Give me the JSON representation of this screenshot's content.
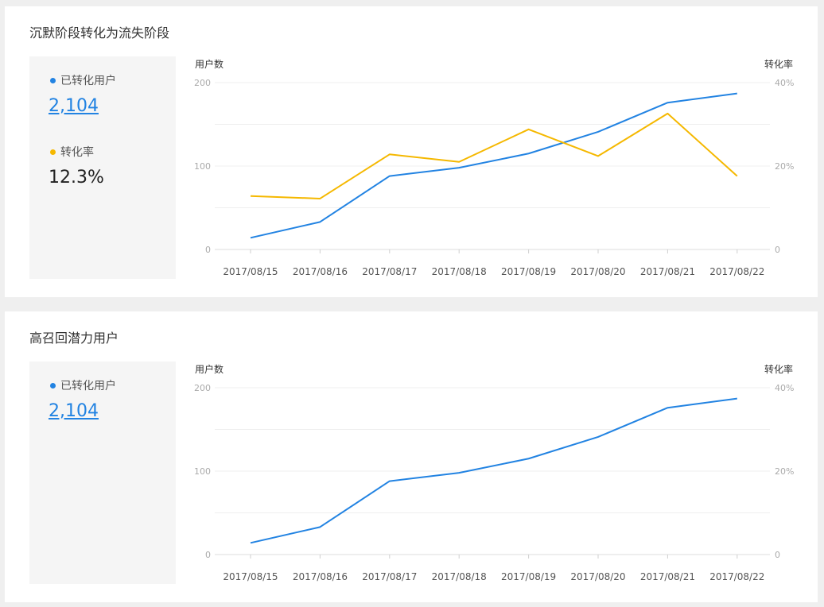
{
  "panels": [
    {
      "title": "沉默阶段转化为流失阶段",
      "metrics": [
        {
          "label": "已转化用户",
          "value": "2,104",
          "color": "#2283e2",
          "link": true
        },
        {
          "label": "转化率",
          "value": "12.3%",
          "color": "#f5b800",
          "link": false
        }
      ],
      "chart_data": {
        "type": "line",
        "x": [
          "2017/08/15",
          "2017/08/16",
          "2017/08/17",
          "2017/08/18",
          "2017/08/19",
          "2017/08/20",
          "2017/08/21",
          "2017/08/22"
        ],
        "ylabel": "用户数",
        "y2label": "转化率",
        "ylim": [
          0,
          200
        ],
        "y2lim": [
          0,
          40
        ],
        "yticks": [
          "0",
          "100",
          "200"
        ],
        "y2ticks": [
          "0",
          "20%",
          "40%"
        ],
        "grid": true,
        "series": [
          {
            "axis": "left",
            "color": "#2283e2",
            "values": [
              14,
              33,
              88,
              98,
              115,
              141,
              176,
              187
            ]
          },
          {
            "axis": "right",
            "color": "#f5b800",
            "values": [
              12.8,
              12.2,
              22.8,
              21.0,
              28.8,
              22.4,
              32.6,
              17.6
            ]
          }
        ]
      }
    },
    {
      "title": "高召回潜力用户",
      "metrics": [
        {
          "label": "已转化用户",
          "value": "2,104",
          "color": "#2283e2",
          "link": true
        }
      ],
      "chart_data": {
        "type": "line",
        "x": [
          "2017/08/15",
          "2017/08/16",
          "2017/08/17",
          "2017/08/18",
          "2017/08/19",
          "2017/08/20",
          "2017/08/21",
          "2017/08/22"
        ],
        "ylabel": "用户数",
        "y2label": "转化率",
        "ylim": [
          0,
          200
        ],
        "y2lim": [
          0,
          40
        ],
        "yticks": [
          "0",
          "100",
          "200"
        ],
        "y2ticks": [
          "0",
          "20%",
          "40%"
        ],
        "grid": true,
        "series": [
          {
            "axis": "left",
            "color": "#2283e2",
            "values": [
              14,
              33,
              88,
              98,
              115,
              141,
              176,
              187
            ]
          }
        ]
      }
    }
  ]
}
